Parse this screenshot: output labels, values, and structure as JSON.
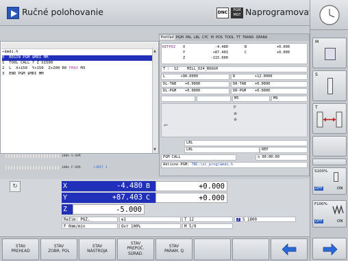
{
  "header": {
    "mode_left": "Ručné polohovanie",
    "mode_right": "Naprogramovať",
    "dnc": "DNC",
    "pgm_top": "PGM",
    "pgm_bot": "MGT"
  },
  "program": {
    "filename": "→$mdi.h",
    "lines": [
      "0  BEGIN PGM $MDI MM",
      "1  TOOL CALL 7 Z S1500",
      "2  L  X+150  Y+150  Z+200 R0 FMAX M3",
      "3  END PGM $MDI MM"
    ],
    "fmax": "FMAX"
  },
  "overrides": {
    "s_ovr": "100% S-OVR",
    "f_ovr": "100% F-OVR",
    "limit": "LIMIT 1"
  },
  "status": {
    "tabs": [
      "Prehľad",
      "PGM",
      "PAL",
      "LBL",
      "CYC",
      "M",
      "POS",
      "TOOL",
      "TT",
      "TRANS",
      "QPARA"
    ],
    "refpos": "REFPOZ",
    "x_label": "X",
    "x_val": "-4.480",
    "y_label": "Y",
    "y_val": "+87.403",
    "z_label": "Z",
    "z_val": "-115.000",
    "b_label": "B",
    "b_val": "+0.000",
    "c_label": "C",
    "c_val": "+0.000",
    "t_label": "T :",
    "t_num": "12",
    "t_name": "MILL_D24_ROUGH",
    "l_label": "L",
    "l_val": "+90.0000",
    "r_label": "R",
    "r_val": "+12.0000",
    "dl_tab": "DL-TAB",
    "dl_tab_val": "+0.0000",
    "dr_tab": "DR-TAB",
    "dr_tab_val": "+0.0000",
    "dl_pgm": "DL-PGM",
    "dl_pgm_val": "+0.0000",
    "dr_pgm": "DR-PGM",
    "dr_pgm_val": "+0.0000",
    "m5": "M5",
    "m9": "M9",
    "lbl1": "LBL",
    "lbl2": "LBL",
    "rep": "REP",
    "pgm_call": "PGM CALL",
    "time": "00:00:00",
    "active_pgm_label": "Aktívne PGM:",
    "active_pgm": "TNC:\\nc_prog\\$mdi.h"
  },
  "positions": {
    "rows": [
      {
        "axis": "X",
        "value": "-4.480",
        "raxis": "B",
        "rvalue": "+0.000"
      },
      {
        "axis": "Y",
        "value": "+87.403",
        "raxis": "C",
        "rvalue": "+0.000"
      },
      {
        "axis": "Z",
        "value": "-5.000"
      }
    ],
    "mode": "Režim: POŽ.",
    "tool_icon": "⊕1",
    "t_field": "T 12",
    "s_field": "S 1800",
    "s_icon": "2",
    "feed": "F 0mm/min",
    "ovr": "Ovr 100%",
    "m_field": "M 5/9"
  },
  "right": {
    "m": "M",
    "s": "S",
    "t": "T",
    "s100": "S100%",
    "f100": "F100%",
    "off": "OFF",
    "on": "ON"
  },
  "softkeys": [
    {
      "l1": "STAV",
      "l2": "PREHĽAD",
      "l3": ""
    },
    {
      "l1": "STAV",
      "l2": "ZOBR. POL",
      "l3": ""
    },
    {
      "l1": "STAV",
      "l2": "NÁSTROJA",
      "l3": ""
    },
    {
      "l1": "STAV",
      "l2": "PREPOČ.",
      "l3": "SÚRAD."
    },
    {
      "l1": "STAV",
      "l2": "PARAM. Q",
      "l3": ""
    }
  ],
  "colors": {
    "accent": "#2130b8",
    "fmax": "#c040c0"
  }
}
